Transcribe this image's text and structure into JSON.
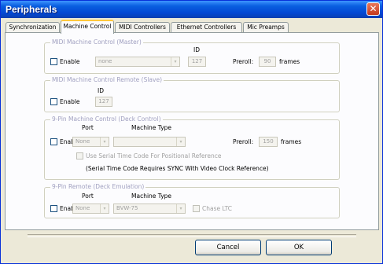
{
  "window": {
    "title": "Peripherals",
    "close_symbol": "✕"
  },
  "tabs": [
    {
      "label": "Synchronization"
    },
    {
      "label": "Machine Control"
    },
    {
      "label": "MIDI Controllers"
    },
    {
      "label": "Ethernet Controllers"
    },
    {
      "label": "Mic Preamps"
    }
  ],
  "active_tab": "Machine Control",
  "mmc_master": {
    "title": "MIDI Machine Control (Master)",
    "enable_label": "Enable",
    "device_value": "none",
    "id_label": "ID",
    "id_value": "127",
    "preroll_label": "Preroll:",
    "preroll_value": "90",
    "frames_label": "frames"
  },
  "mmc_remote": {
    "title": "MIDI Machine Control Remote (Slave)",
    "enable_label": "Enable",
    "id_label": "ID",
    "id_value": "127"
  },
  "nine_pin_control": {
    "title": "9-Pin Machine Control (Deck Control)",
    "enable_label": "Enable",
    "port_label": "Port",
    "port_value": "None",
    "machine_type_label": "Machine Type",
    "machine_type_value": "",
    "preroll_label": "Preroll:",
    "preroll_value": "150",
    "frames_label": "frames",
    "serial_tc_label": "Use Serial Time Code For Positional Reference",
    "note": "(Serial Time Code Requires SYNC With Video Clock Reference)"
  },
  "nine_pin_remote": {
    "title": "9-Pin Remote (Deck Emulation)",
    "enable_label": "Enable",
    "port_label": "Port",
    "port_value": "None",
    "machine_type_label": "Machine Type",
    "machine_type_value": "BVW-75",
    "chase_ltc_label": "Chase LTC"
  },
  "buttons": {
    "cancel": "Cancel",
    "ok": "OK"
  },
  "icons": {
    "dropdown_arrow": "▾"
  }
}
